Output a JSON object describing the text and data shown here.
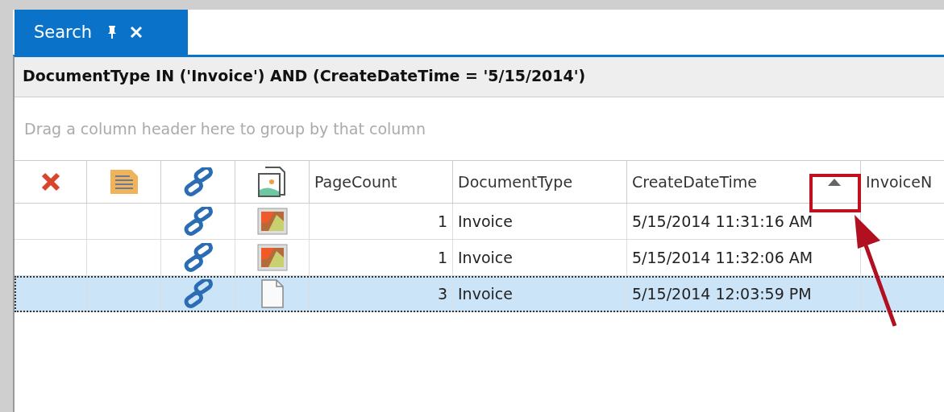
{
  "tab": {
    "label": "Search",
    "selected": true
  },
  "filter": "DocumentType IN ('Invoice') AND (CreateDateTime = '5/15/2014')",
  "group_panel": {
    "placeholder": "Drag a column header here to group by that column"
  },
  "columns": [
    {
      "kind": "delete-icon"
    },
    {
      "kind": "document-icon"
    },
    {
      "kind": "link-icon"
    },
    {
      "kind": "image-icon"
    },
    {
      "kind": "text",
      "label": "PageCount"
    },
    {
      "kind": "text",
      "label": "DocumentType"
    },
    {
      "kind": "text",
      "label": "CreateDateTime",
      "sorted_ascending": true
    },
    {
      "kind": "text",
      "label": "InvoiceN"
    }
  ],
  "rows": [
    {
      "selected": false,
      "kind": "picture",
      "page_count": "1",
      "document_type": "Invoice",
      "create_date_time": "5/15/2014 11:31:16 AM"
    },
    {
      "selected": false,
      "kind": "picture",
      "page_count": "1",
      "document_type": "Invoice",
      "create_date_time": "5/15/2014 11:32:06 AM"
    },
    {
      "selected": true,
      "kind": "blank",
      "page_count": "3",
      "document_type": "Invoice",
      "create_date_time": "5/15/2014 12:03:59 PM"
    }
  ]
}
